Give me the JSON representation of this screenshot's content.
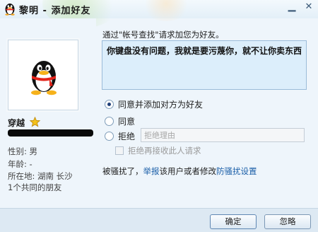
{
  "window": {
    "title": "黎明 - 添加好友",
    "icon": "qq-penguin-icon",
    "minimize_glyph": "▁",
    "close_glyph": "✕"
  },
  "profile": {
    "avatar": "qq-penguin-avatar",
    "nickname": "穿越",
    "gender": "性别: 男",
    "age": "年龄: -",
    "location": "所在地: 湖南  长沙",
    "mutual_friends": "1个共同的朋友"
  },
  "request": {
    "prompt": "通过\"帐号查找\"请求加您为好友。",
    "message": "你键盘没有问题，我就是要污蔑你，就不让你卖东西"
  },
  "options": {
    "accept_and_add": "同意并添加对方为好友",
    "accept": "同意",
    "reject": "拒绝",
    "reject_reason_placeholder": "拒绝理由",
    "block_future": "拒绝再接收此人请求",
    "selected": "accept_and_add"
  },
  "harassment": {
    "prefix": "被骚扰了，",
    "report_link": "举报",
    "middle": "该用户或者修改",
    "settings_link": "防骚扰设置"
  },
  "buttons": {
    "ok": "确定",
    "ignore": "忽略"
  },
  "colors": {
    "link": "#1b5fa8",
    "textbox_bg": "#dceefb",
    "window_bg": "#eef5fb"
  }
}
